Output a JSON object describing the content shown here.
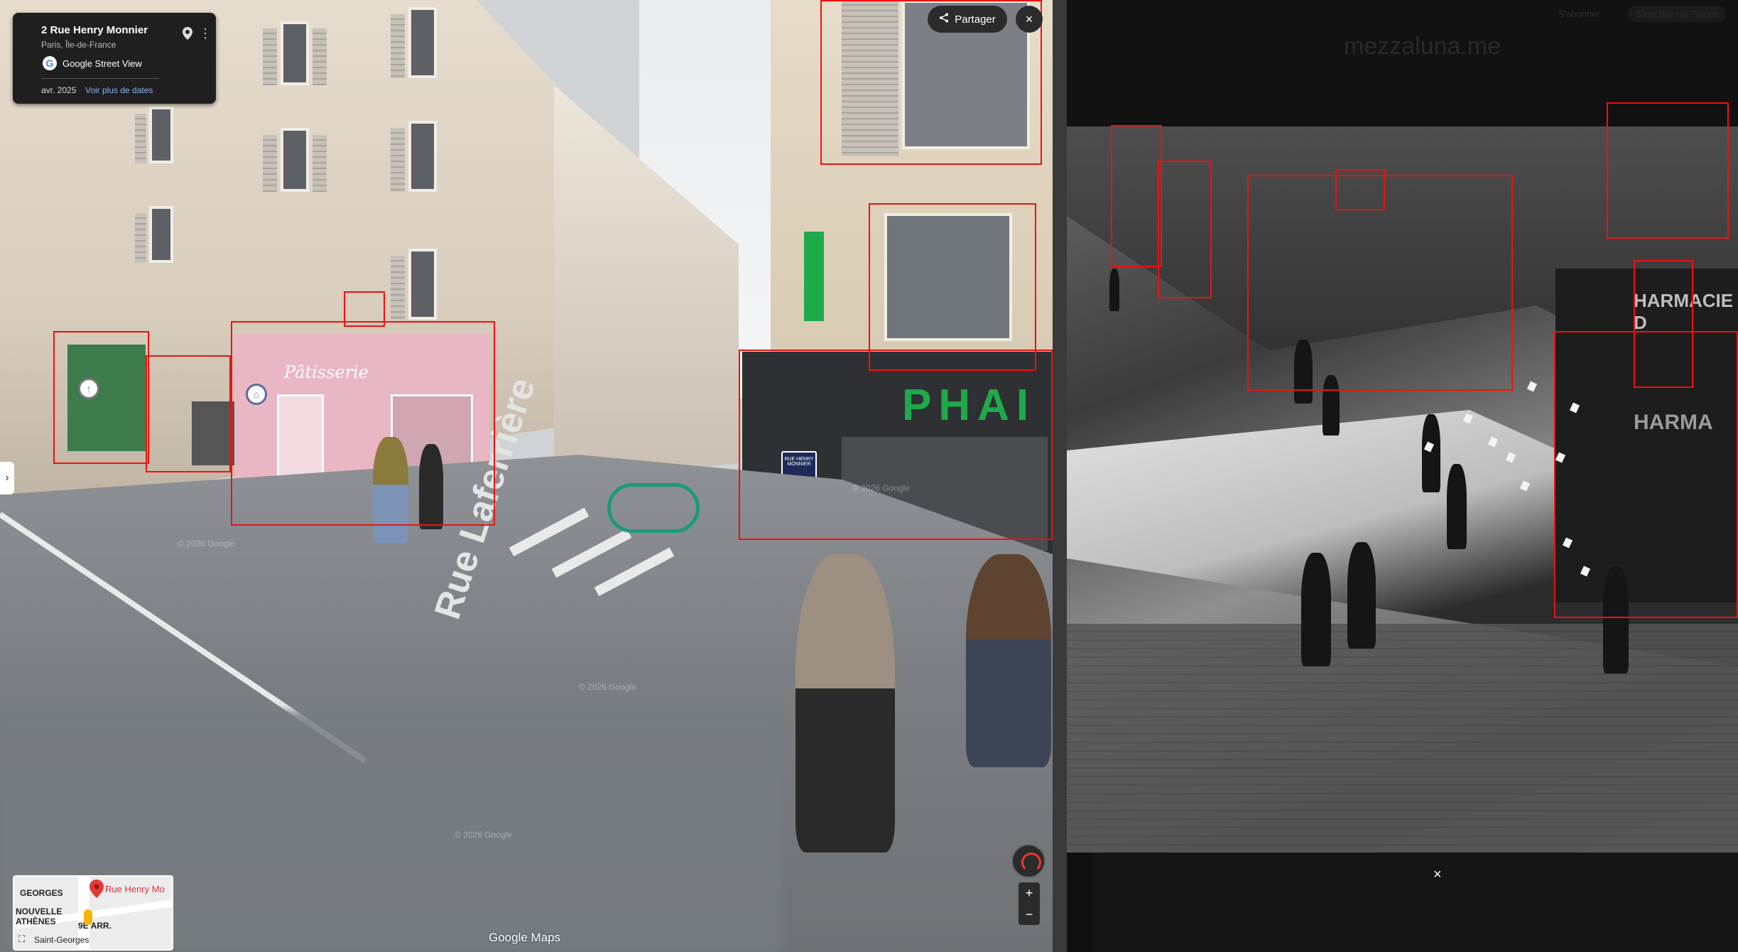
{
  "streetview": {
    "place": {
      "title": "2 Rue Henry Monnier",
      "subtitle": "Paris, Île-de-France",
      "source_label": "Google Street View",
      "date": "avr. 2025",
      "more_dates_link": "Voir plus de dates",
      "icons": {
        "pin": "location-pin-icon",
        "menu": "more-vert-icon",
        "google": "google-g-logo-icon"
      }
    },
    "share_label": "Partager",
    "close_glyph": "×",
    "back_glyph": "›",
    "scene_text": {
      "shop_sign_right": "PHAI",
      "street_marking": "Rue Laferrière",
      "pink_shop_sign": "Pâtisserie",
      "street_plaque": "RUE HENRY MONNIER"
    },
    "watermark": "© 2026 Google",
    "minimap": {
      "labels": [
        "GEORGES",
        "NOUVELLE",
        "ATHÈNES",
        "9E ARR.",
        "Saint-Georges"
      ],
      "street_label": "Rue Henry Mo"
    },
    "zoom": {
      "in": "+",
      "out": "−"
    },
    "footer_logo": "Google Maps"
  },
  "photo_pane": {
    "brand": "mezzaluna.me",
    "top_links": [
      "S'abonner",
      "S'inscrire sur Tumblr"
    ],
    "storefront_text": [
      "HARMACIE D",
      "HARMA"
    ],
    "close_glyph": "×"
  },
  "colors": {
    "annotation_box": "#ee1111",
    "link": "#8ab4f8",
    "pharmacy_green": "#1faa4a",
    "card_bg": "#1f1f1f"
  }
}
